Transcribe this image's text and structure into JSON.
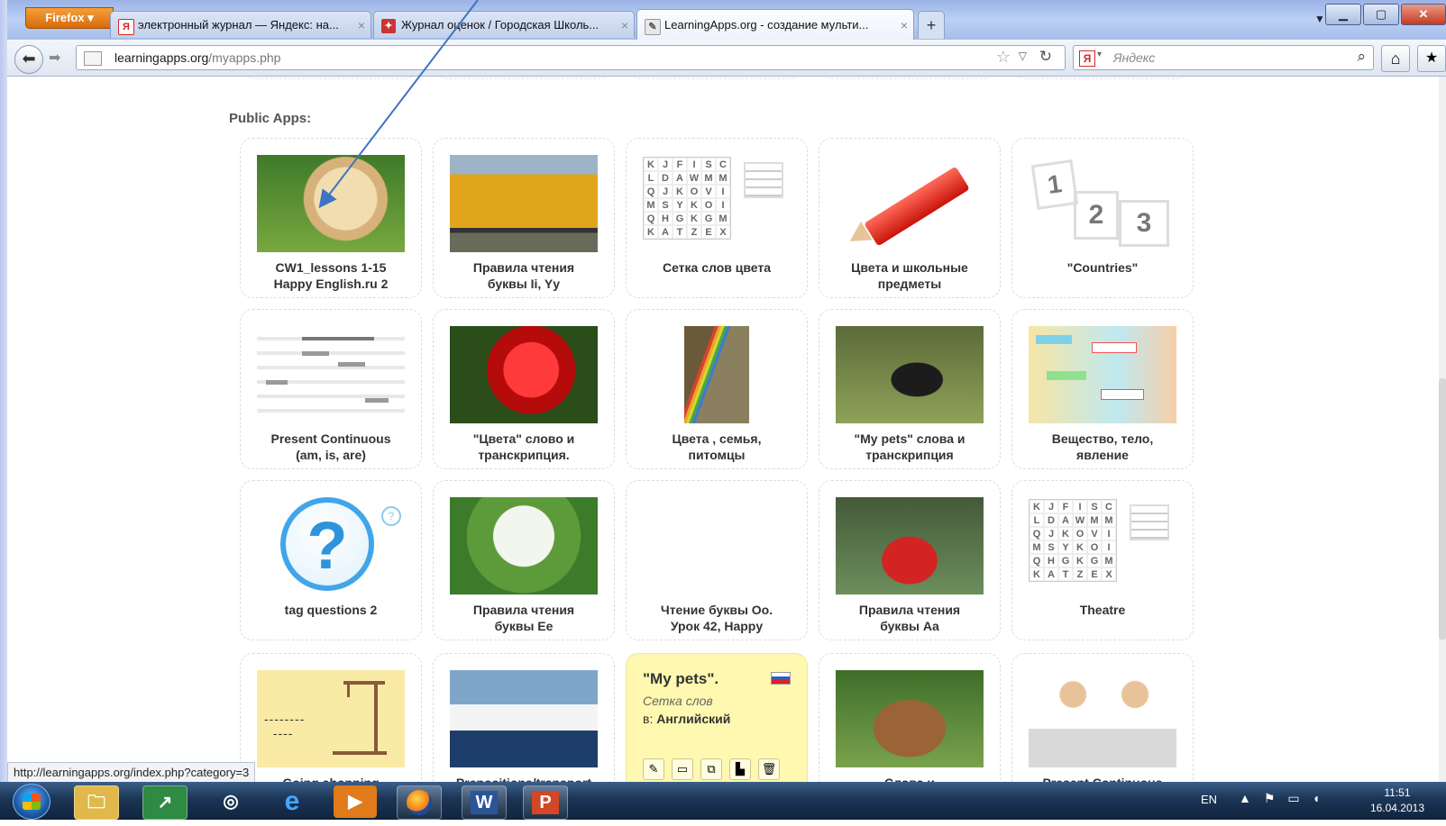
{
  "browser": {
    "firefox_label": "Firefox",
    "tabs": [
      {
        "title": "электронный журнал — Яндекс: на...",
        "icon": "yandex-icon",
        "close": "×"
      },
      {
        "title": "Журнал оценок / Городская Школь...",
        "icon": "journal-icon",
        "close": "×"
      },
      {
        "title": "LearningApps.org - создание мульти...",
        "icon": "learningapps-icon",
        "close": "×"
      }
    ],
    "new_tab": "+",
    "url_host": "learningapps.org",
    "url_path": "/myapps.php",
    "search_placeholder": "Яндекс",
    "search_engine_logo": "Я"
  },
  "page": {
    "section_title": "Public Apps:",
    "cards": [
      {
        "title": "CW1_lessons 1-15\nHappy English.ru 2",
        "thumb": "dog-photo"
      },
      {
        "title": "Правила чтения\nбуквы Ii, Yy",
        "thumb": "bus-photo"
      },
      {
        "title": "Сетка слов цвета",
        "thumb": "word-grid"
      },
      {
        "title": "Цвета и школьные\nпредметы",
        "thumb": "red-pencil"
      },
      {
        "title": "\"Countries\"",
        "thumb": "numbers-123"
      },
      {
        "title": "Present Continuous\n(am, is, are)",
        "thumb": "gap-text"
      },
      {
        "title": "\"Цвета\" слово и\nтранскрипция.",
        "thumb": "rose-photo"
      },
      {
        "title": "Цвета , семья,\nпитомцы",
        "thumb": "rainbow-photo"
      },
      {
        "title": "\"My pets\" слова и\nтранскрипция",
        "thumb": "black-dog-photo"
      },
      {
        "title": "Вещество, тело,\nявление",
        "thumb": "matching-pairs"
      },
      {
        "title": "tag questions 2",
        "thumb": "question-icon"
      },
      {
        "title": "Правила чтения\nбуквы Ee",
        "thumb": "tree-photo"
      },
      {
        "title": "Чтение буквы Oo.\nУрок 42, Happy",
        "thumb": "puppy-kitten-photo"
      },
      {
        "title": "Правила чтения\nбуквы Aa",
        "thumb": "toy-car-photo"
      },
      {
        "title": "Theatre",
        "thumb": "word-grid"
      },
      {
        "title": "Going shopping",
        "thumb": "hangman"
      },
      {
        "title": "Prepositions/transport",
        "thumb": "ship-photo"
      },
      {
        "title": "",
        "thumb": "yellow"
      },
      {
        "title": "Слова и",
        "thumb": "bench-photo"
      },
      {
        "title": "Present Continuous",
        "thumb": "girls-photo"
      }
    ],
    "yellow_card": {
      "title": "\"My pets\".",
      "subtitle": "Сетка слов",
      "lang_prefix": "в:",
      "lang": "Английский"
    },
    "grid_letters": [
      "K",
      "J",
      "F",
      "I",
      "S",
      "C",
      "L",
      "D",
      "A",
      "W",
      "M",
      "M",
      "Q",
      "J",
      "K",
      "O",
      "V",
      "I",
      "M",
      "S",
      "Y",
      "K",
      "O",
      "I",
      "Q",
      "H",
      "G",
      "K",
      "G",
      "M",
      "K",
      "A",
      "T",
      "Z",
      "E",
      "X"
    ],
    "numbers": [
      "1",
      "2",
      "3"
    ],
    "status_url": "http://learningapps.org/index.php?category=3"
  },
  "taskbar": {
    "lang": "EN",
    "time": "11:51",
    "date": "16.04.2013",
    "word_letter": "W",
    "ppt_letter": "P"
  },
  "colors": {
    "accent": "#1f5fa8",
    "arrow": "#3f73c4",
    "yellow_card": "#fff8b0"
  }
}
